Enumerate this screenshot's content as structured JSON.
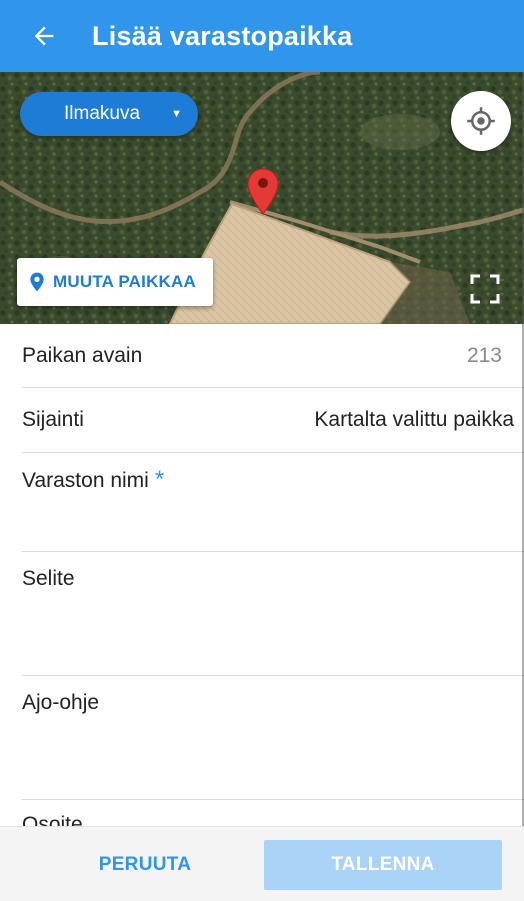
{
  "appbar": {
    "title": "Lisää varastopaikka",
    "back_icon": "arrow-left-icon"
  },
  "map": {
    "layer_select": {
      "value": "Ilmakuva"
    },
    "move_location_label": "MUUTA PAIKKAA",
    "icons": {
      "locate": "crosshair-icon",
      "marker": "map-marker-icon",
      "pin": "location-pin-icon",
      "fullscreen": "fullscreen-icon"
    }
  },
  "form": {
    "place_key": {
      "label": "Paikan avain",
      "value": "213"
    },
    "location": {
      "label": "Sijainti",
      "value": "Kartalta valittu paikka"
    },
    "storage_name": {
      "label": "Varaston nimi",
      "required_mark": "*"
    },
    "description": {
      "label": "Selite"
    },
    "driving_directions": {
      "label": "Ajo-ohje"
    },
    "address": {
      "label": "Osoite"
    }
  },
  "footer": {
    "cancel_label": "PERUUTA",
    "save_label": "TALLENNA"
  },
  "colors": {
    "primary": "#2f96ec",
    "primary_dark": "#1f7cd6",
    "save_disabled": "#a9d3f7",
    "marker": "#e53935"
  }
}
